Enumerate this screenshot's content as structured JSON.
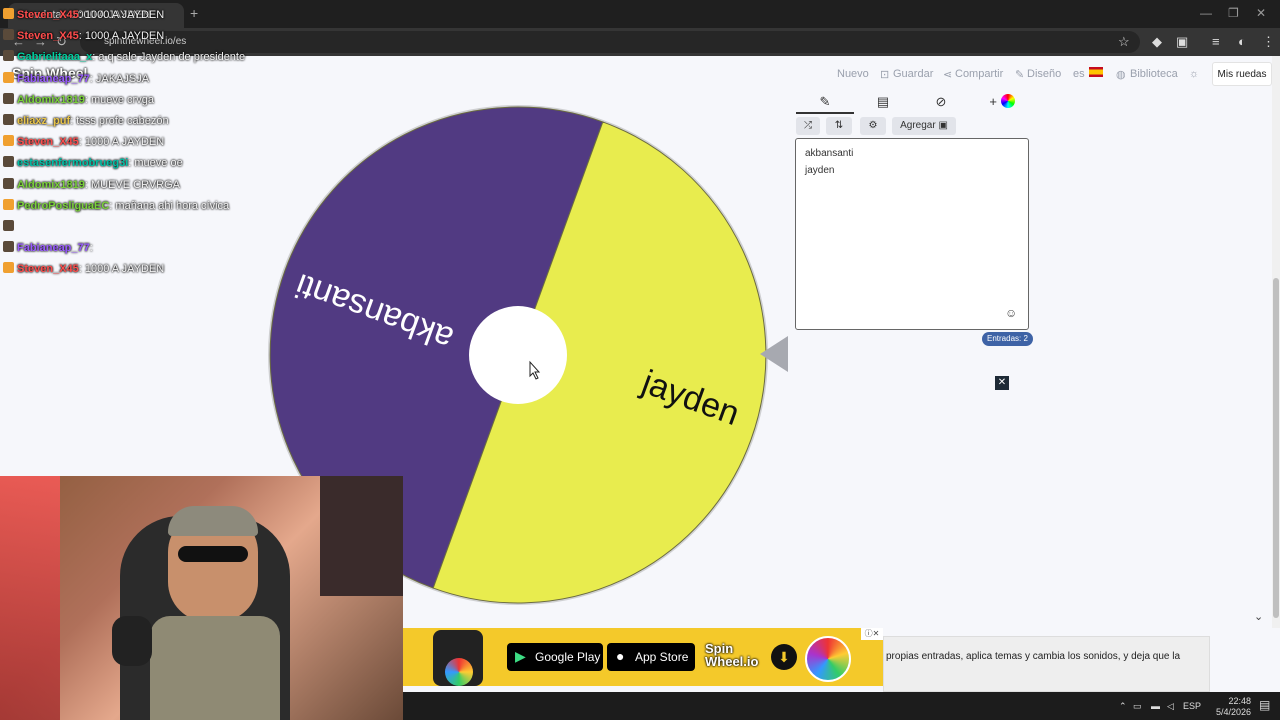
{
  "browser": {
    "tab_title": "ruleta - 1000 A JAYDEN",
    "url": "spinthewheel.io/es"
  },
  "site": {
    "brand": "Spin Wheel",
    "nav": {
      "nuevo": "Nuevo",
      "guardar": "Guardar",
      "compartir": "Compartir",
      "diseno": "Diseño",
      "lang": "es",
      "biblioteca": "Biblioteca",
      "mis_ruedas": "Mis ruedas"
    }
  },
  "wheel": {
    "segments": [
      {
        "label": "akbansanti",
        "color": "#513a82"
      },
      {
        "label": "jayden",
        "color": "#e8ec4e"
      }
    ]
  },
  "editor": {
    "agregar": "Agregar",
    "entries": [
      "akbansanti",
      "jayden"
    ],
    "entries_badge": "Entradas: 2"
  },
  "chat": [
    {
      "user": "Steven_X45",
      "msg": ": 1000 A JAYDEN",
      "color": "#ff4d4d"
    },
    {
      "user": "Steven_X45",
      "msg": ": 1000 A JAYDEN",
      "color": "#ff4d4d"
    },
    {
      "user": "Gabrielitaaa_x",
      "msg": ": a q sale Jayden de presidente",
      "color": "#00d0a0"
    },
    {
      "user": "Fabianeap_77",
      "msg": ": JAKAJSJA",
      "color": "#9a5cff"
    },
    {
      "user": "Aldomix1819",
      "msg": ": mueve crvga",
      "color": "#7ad13b"
    },
    {
      "user": "eliaxz_puf",
      "msg": ": tsss profe cabezón",
      "color": "#e8c44a"
    },
    {
      "user": "Steven_X45",
      "msg": ": 1000 A JAYDEN",
      "color": "#ff4d4d"
    },
    {
      "user": "estasenfermobrueg3i",
      "msg": ": mueve oe",
      "color": "#00c2a8"
    },
    {
      "user": "Aldomix1819",
      "msg": ": MUEVE CRVRGA",
      "color": "#7ad13b"
    },
    {
      "user": "PedroPosliguaEC",
      "msg": ": mañana ahi hora cívica",
      "color": "#7ad13b"
    },
    {
      "user": "",
      "msg": "",
      "color": "#ffffff"
    },
    {
      "user": "Fabianeap_77",
      "msg": ":",
      "color": "#9a5cff"
    },
    {
      "user": "Steven_X45",
      "msg": ": 1000 A JAYDEN",
      "color": "#ff4d4d"
    }
  ],
  "ad": {
    "google_play": "Google Play",
    "app_store": "App Store",
    "brand_line1": "Spin",
    "brand_line2": "Wheel.io",
    "side_text": "propias entradas, aplica temas y cambia los sonidos, y deja que la"
  },
  "taskbar": {
    "lang": "ESP",
    "time": "22:48",
    "date": "5/4/2026"
  }
}
